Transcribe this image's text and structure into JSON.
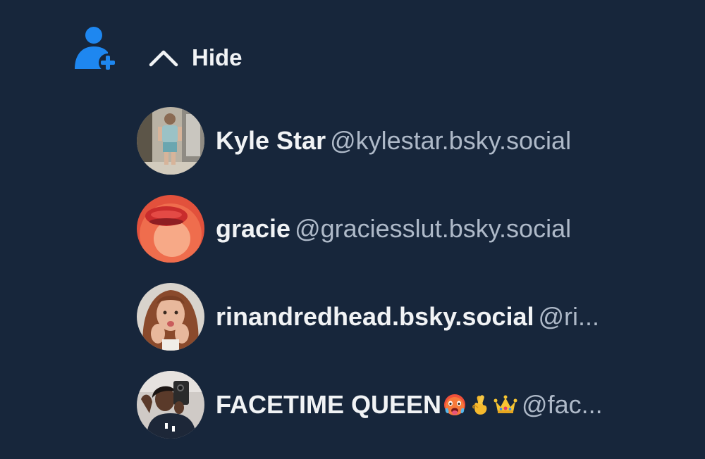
{
  "header": {
    "follow_icon": "person-plus-icon",
    "toggle_icon": "chevron-up-icon",
    "hide_label": "Hide"
  },
  "accounts": [
    {
      "display_name": "Kyle Star",
      "handle": "@kylestar.bsky.social",
      "avatar": "photo-person-mirror-selfie"
    },
    {
      "display_name": "gracie",
      "handle": "@graciesslut.bsky.social",
      "avatar": "photo-red-lips"
    },
    {
      "display_name": "rinandredhead.bsky.social",
      "handle": "@ri...",
      "avatar": "photo-redhead-woman"
    },
    {
      "display_name": "FACETIME QUEEN",
      "handle": "@fac...",
      "avatar": "photo-phone-selfie",
      "name_emojis": [
        "hot-face-emoji",
        "crossed-fingers-emoji",
        "crown-emoji"
      ]
    }
  ],
  "colors": {
    "background": "#17263b",
    "accent": "#1e87f0",
    "text_primary": "#f1f3f5",
    "text_secondary": "#aeb9c8"
  }
}
